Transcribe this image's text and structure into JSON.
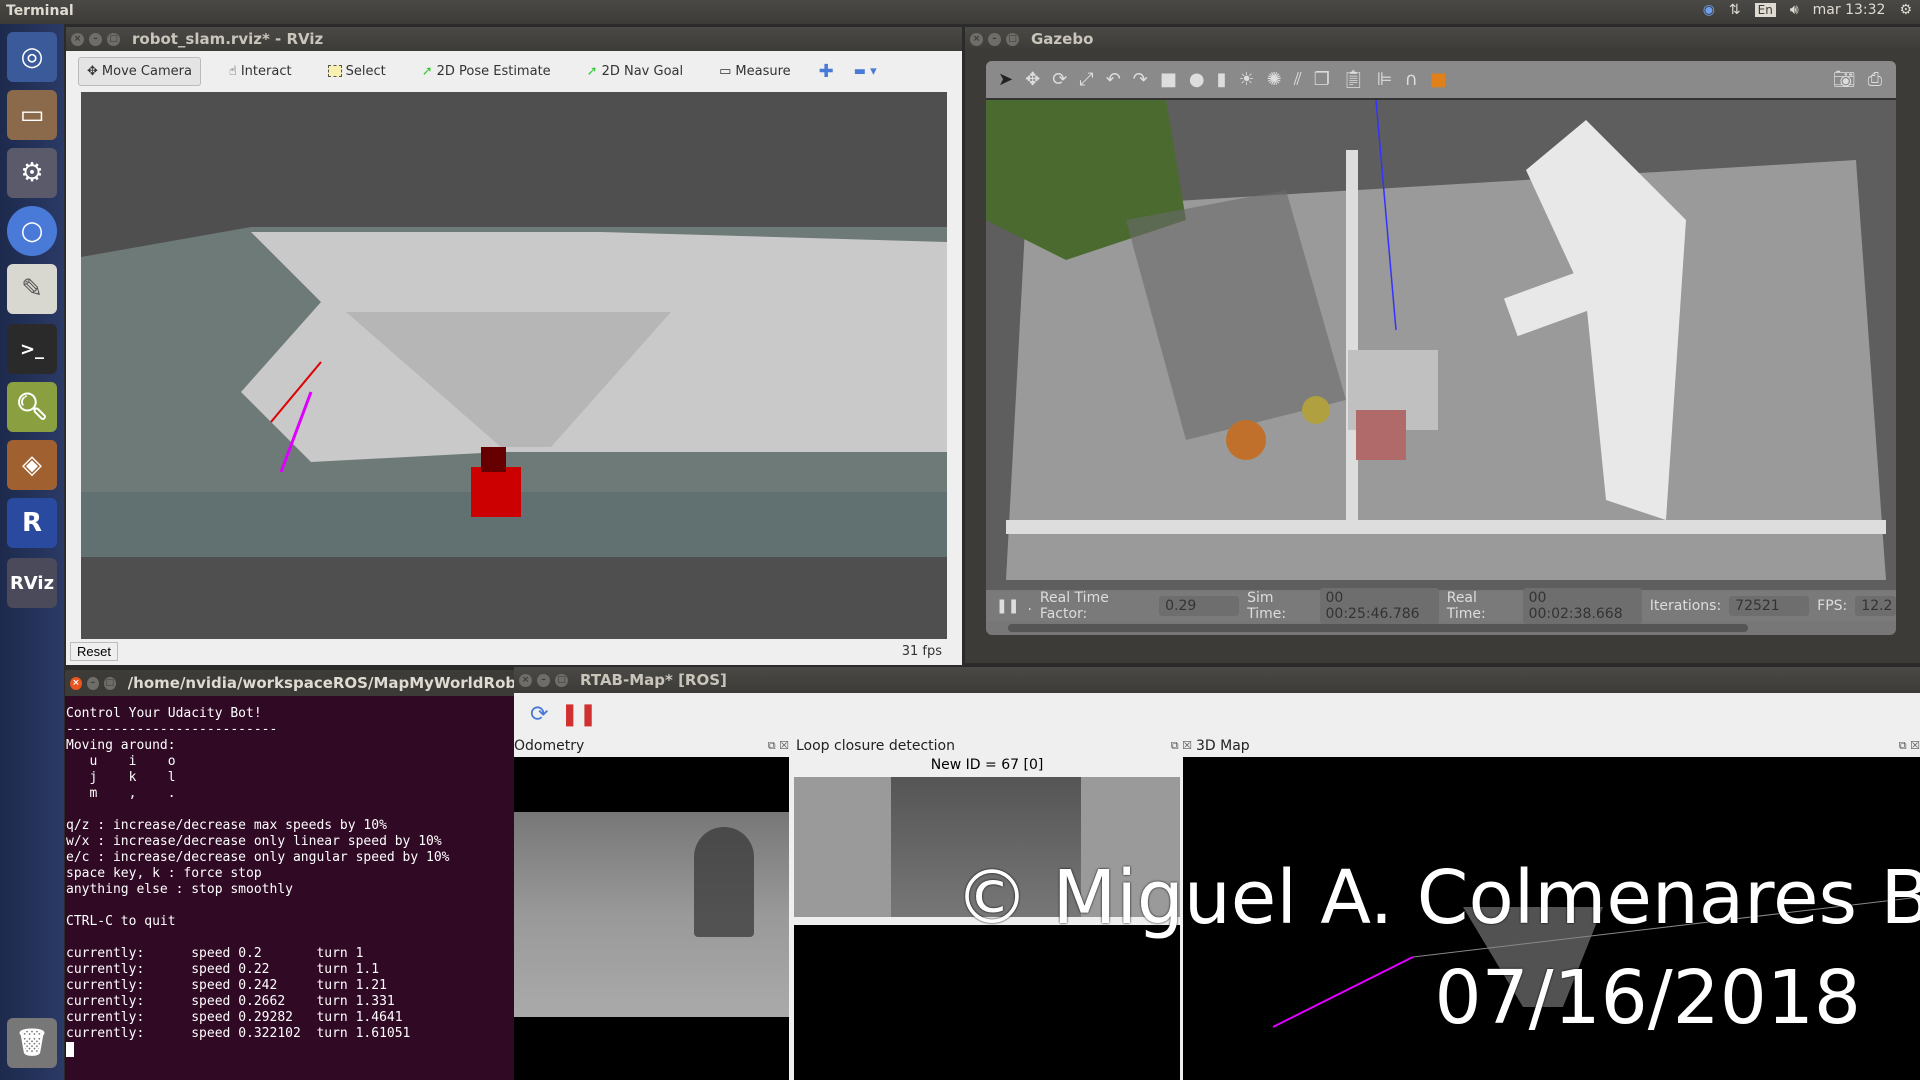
{
  "topbar": {
    "app": "Terminal",
    "lang": "En",
    "clock": "mar 13:32"
  },
  "launcher": {
    "items": [
      "ubuntu-dash",
      "files",
      "system-settings",
      "chromium",
      "text-editor",
      "terminal",
      "image-viewer",
      "virtualbox",
      "rstudio",
      "rviz",
      "trash"
    ],
    "rviz_label": "RViz",
    "r_label": "R"
  },
  "rviz": {
    "title": "robot_slam.rviz* - RViz",
    "tools": [
      "Move Camera",
      "Interact",
      "Select",
      "2D Pose Estimate",
      "2D Nav Goal",
      "Measure"
    ],
    "reset": "Reset",
    "fps": "31 fps"
  },
  "gazebo": {
    "title": "Gazebo",
    "status": {
      "rtf_label": "Real Time Factor:",
      "rtf": "0.29",
      "sim_label": "Sim Time:",
      "sim": "00 00:25:46.786",
      "real_label": "Real Time:",
      "real": "00 00:02:38.668",
      "iter_label": "Iterations:",
      "iter": "72521",
      "fps_label": "FPS:",
      "fps": "12.2"
    }
  },
  "terminal": {
    "title": "/home/nvidia/workspaceROS/MapMyWorldRobot-P",
    "lines": [
      "Control Your Udacity Bot!",
      "---------------------------",
      "Moving around:",
      "   u    i    o",
      "   j    k    l",
      "   m    ,    .",
      "",
      "q/z : increase/decrease max speeds by 10%",
      "w/x : increase/decrease only linear speed by 10%",
      "e/c : increase/decrease only angular speed by 10%",
      "space key, k : force stop",
      "anything else : stop smoothly",
      "",
      "CTRL-C to quit",
      "",
      "currently:\tspeed 0.2 \tturn 1",
      "currently:\tspeed 0.22\tturn 1.1",
      "currently:\tspeed 0.242\tturn 1.21",
      "currently:\tspeed 0.2662\tturn 1.331",
      "currently:\tspeed 0.29282\tturn 1.4641",
      "currently:\tspeed 0.322102\tturn 1.61051"
    ]
  },
  "rtab": {
    "title": "RTAB-Map* [ROS]",
    "panels": {
      "odometry": "Odometry",
      "loop": "Loop closure detection",
      "map3d": "3D Map"
    },
    "new_id": "New ID = 67 [0]"
  },
  "watermark": {
    "line1": "© Miguel A. Colmenares B.",
    "line2": "07/16/2018"
  },
  "colors": {
    "ubuntu_orange": "#e95420",
    "terminal_bg": "#300a24",
    "robot_red": "#d00000"
  }
}
